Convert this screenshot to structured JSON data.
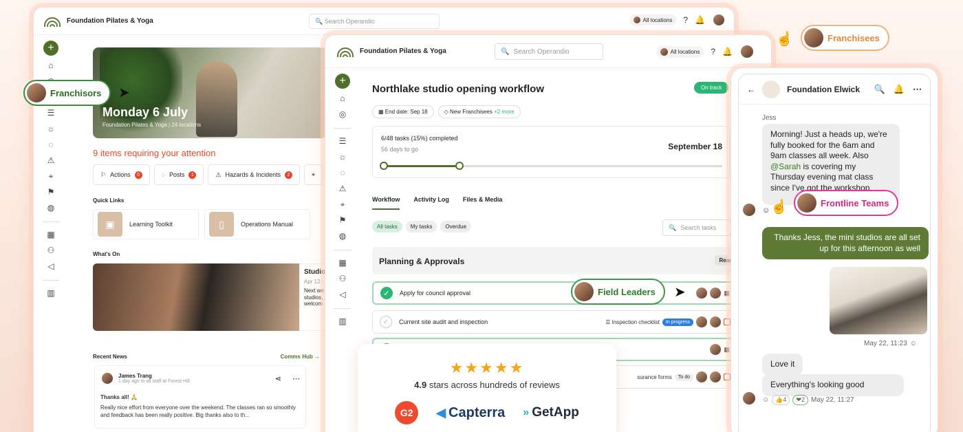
{
  "colors": {
    "brand_green": "#4f6f2a",
    "accent_red": "#e04a2a",
    "on_track": "#2bb673",
    "bubble_out": "#5e7a35"
  },
  "w1": {
    "brand": "Foundation Pilates & Yoga",
    "search_placeholder": "Search Operandio",
    "locations": "All locations",
    "hero_title": "Monday 6 July",
    "hero_sub": "Foundation Pilates & Yoga | 24 locations",
    "attention": "9 items requiring your attention",
    "chips": [
      {
        "label": "Actions",
        "count": "0"
      },
      {
        "label": "Posts",
        "count": "1"
      },
      {
        "label": "Hazards & Incidents",
        "count": "2"
      }
    ],
    "quick_links_label": "Quick Links",
    "quick_links": [
      "Learning Toolkit",
      "Operations Manual"
    ],
    "whats_on_label": "What's On",
    "whats_on_card": {
      "title": "Studio",
      "date": "Apr 12 -",
      "body": "Next we studios, welcom"
    },
    "recent_news_label": "Recent News",
    "comms_hub": "Comms Hub →",
    "news": {
      "author": "James Trang",
      "meta": "1 day ago to all staff at Forest Hill",
      "title": "Thanks all! 🙏",
      "body": "Really nice effort from everyone over the weekend. The classes ran so smoothly and feedback has been really positive. Big thanks also to th..."
    }
  },
  "w2": {
    "brand": "Foundation Pilates & Yoga",
    "search_placeholder": "Search Operandio",
    "locations": "All locations",
    "title": "Northlake studio opening workflow",
    "status": "On track",
    "end_date": "End date: Sep 18",
    "tag": "New Franchisees",
    "tag_more": "+2 more",
    "progress_text": "6/48 tasks (15%) completed",
    "progress_days": "56 days to go",
    "progress_date": "September 18",
    "progress_fraction": 0.23,
    "tabs": [
      "Workflow",
      "Activity Log",
      "Files & Media"
    ],
    "filters": [
      "All tasks",
      "My tasks",
      "Overdue"
    ],
    "task_search_placeholder": "Search tasks",
    "group_title": "Planning & Approvals",
    "group_read": "Read",
    "tasks": [
      {
        "label": "Apply for council approval"
      },
      {
        "label": "Current site audit and inspection",
        "checklist": "Inspection checklist",
        "status": "In progress"
      },
      {
        "label": ""
      },
      {
        "label": "",
        "checklist": "surance forms",
        "status": "To do"
      }
    ]
  },
  "reviews": {
    "stars": "★★★★★",
    "rating": "4.9",
    "rating_text": " stars across hundreds of reviews",
    "g2": "G2",
    "capterra": "Capterra",
    "getapp": "GetApp"
  },
  "chat": {
    "title": "Foundation Elwick",
    "sender": "Jess",
    "msg1_a": "Morning! Just a heads up, we're fully booked for the 6am and 9am classes all week. Also ",
    "msg1_mention": "@Sarah",
    "msg1_b": " is covering my Thursday evening mat class since I've got the workshop.",
    "msg2": "Thanks Jess, the mini studios are all set up for this afternoon as well",
    "stamp1": "May 22, 11:23",
    "msg3": "Love it",
    "msg4": "Everything's looking good",
    "react1": "👍4",
    "react2": "❤2",
    "stamp2": "May 22, 11:27"
  },
  "callouts": {
    "franchisees": "Franchisees",
    "franchisors": "Franchisors",
    "frontline": "Frontline Teams",
    "field_leaders": "Field Leaders"
  }
}
